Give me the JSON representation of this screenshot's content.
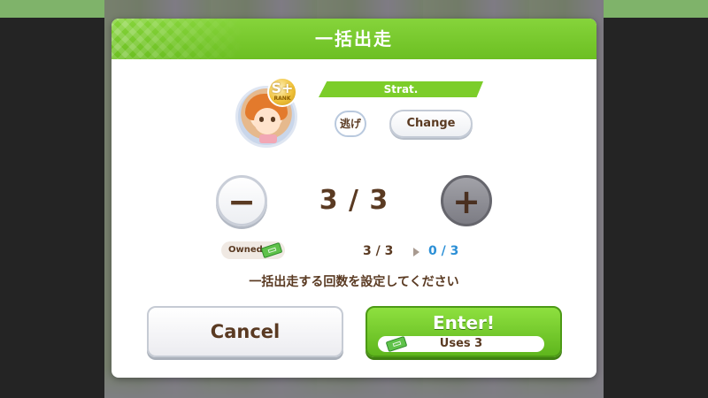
{
  "dialog": {
    "title": "一括出走",
    "strategy": {
      "header": "Strat.",
      "current": "逃げ",
      "change_label": "Change"
    },
    "character": {
      "rank": "S+",
      "rank_sub": "RANK"
    },
    "counter": {
      "minus_symbol": "−",
      "plus_symbol": "+",
      "display": "3 / 3"
    },
    "owned": {
      "label": "Owned",
      "before": "3 / 3",
      "after": "0 / 3"
    },
    "instruction": "一括出走する回数を設定してください",
    "buttons": {
      "cancel": "Cancel",
      "enter": "Enter!",
      "uses": "Uses 3"
    }
  },
  "colors": {
    "header_green": "#6cbf22",
    "accent_blue": "#2b8fd6",
    "text_brown": "#5a3a22"
  },
  "icons": [
    "ticket-icon",
    "rank-badge-icon",
    "arrow-right-icon"
  ]
}
